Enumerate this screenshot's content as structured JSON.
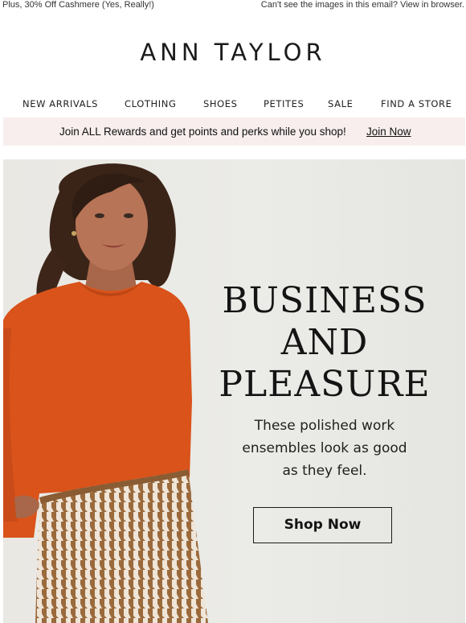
{
  "preheader": {
    "left_text": "Plus, 30% Off Cashmere (Yes, Really!)",
    "right_text": "Can't see the images in this email? View in browser."
  },
  "brand": {
    "logo_text": "ANN TAYLOR"
  },
  "nav": {
    "items": [
      {
        "label": "NEW ARRIVALS"
      },
      {
        "label": "CLOTHING"
      },
      {
        "label": "SHOES"
      },
      {
        "label": "PETITES"
      },
      {
        "label": "SALE"
      },
      {
        "label": "FIND A STORE"
      }
    ]
  },
  "rewards": {
    "message": "Join ALL Rewards and get points and perks while you shop!",
    "link_label": "Join Now",
    "background_color": "#f7eeed"
  },
  "hero": {
    "headline_lines": [
      "BUSINESS",
      "AND",
      "PLEASURE"
    ],
    "subtext_lines": [
      "These polished work",
      "ensembles look as good",
      "as they feel."
    ],
    "cta_label": "Shop Now",
    "image_subject": "woman in orange sweater and houndstooth skirt",
    "sweater_color": "#d9531a",
    "skirt_colors": [
      "#9b6a3c",
      "#efe5d8"
    ]
  }
}
